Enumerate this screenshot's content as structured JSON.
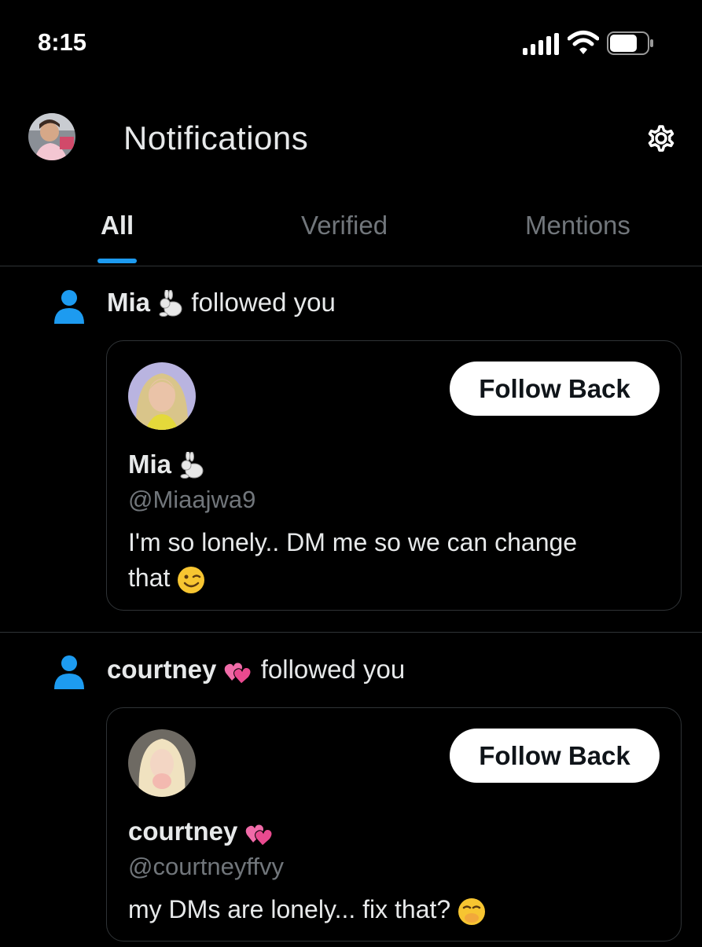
{
  "status": {
    "time": "8:15"
  },
  "header": {
    "title": "Notifications",
    "avatar_icon": "profile-avatar",
    "settings_icon": "gear-icon"
  },
  "tabs": [
    {
      "label": "All",
      "active": true
    },
    {
      "label": "Verified",
      "active": false
    },
    {
      "label": "Mentions",
      "active": false
    }
  ],
  "colors": {
    "accent": "#1d9bf0",
    "background": "#000000",
    "divider": "#2f3336",
    "muted_text": "#71767b"
  },
  "notifications": [
    {
      "name": "Mia",
      "name_emoji": "rabbit",
      "action": "followed you",
      "card": {
        "name": "Mia",
        "handle": "@Miaajwa9",
        "bio_line1": "I'm so lonely.. DM me so we can change",
        "bio_line2": "that",
        "bio_emoji": "winking-face",
        "button": "Follow Back"
      }
    },
    {
      "name": "courtney",
      "name_emoji": "two-hearts",
      "action": "followed you",
      "card": {
        "name": "courtney",
        "handle": "@courtneyffvy",
        "bio": "my DMs are lonely... fix that?",
        "bio_emoji": "hand-over-mouth-face",
        "button": "Follow Back"
      }
    }
  ]
}
